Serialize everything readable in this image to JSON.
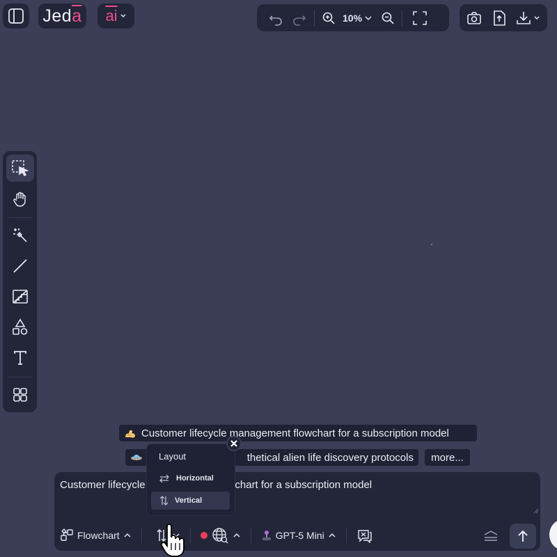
{
  "header": {
    "logo_text_prefix": "Jed",
    "logo_text_accent": "a",
    "ai_label": "ai"
  },
  "toolbar": {
    "zoom_level": "10%"
  },
  "suggestions": [
    {
      "text": "Customer lifecycle management flowchart for a subscription model",
      "icon": "muscle-emoji"
    },
    {
      "text": "thetical alien life discovery protocols",
      "icon": "ufo-emoji"
    }
  ],
  "more_label": "more...",
  "prompt": {
    "value_left": "Customer lifecycle",
    "value_right": "wchart for a subscription model"
  },
  "footer": {
    "diagram_type": "Flowchart",
    "model": "GPT-5 Mini"
  },
  "layout_popup": {
    "title": "Layout",
    "options": [
      {
        "label": "Horizontal",
        "selected": false
      },
      {
        "label": "Vertical",
        "selected": true
      }
    ]
  },
  "colors": {
    "background": "#3c3e57",
    "panel": "#232538",
    "accent": "#e8508a",
    "record_dot": "#ee3e5e"
  }
}
